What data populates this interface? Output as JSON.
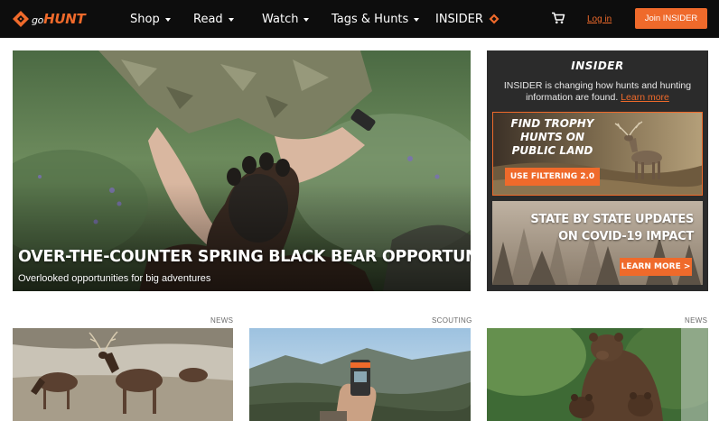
{
  "nav": {
    "logo": {
      "go": "go",
      "hunt": "HUNT"
    },
    "items": [
      {
        "label": "Shop",
        "has_dropdown": true
      },
      {
        "label": "Read",
        "has_dropdown": true
      },
      {
        "label": "Watch",
        "has_dropdown": true
      },
      {
        "label": "Tags & Hunts",
        "has_dropdown": true
      },
      {
        "label": "INSIDER",
        "icon": "insider-logo-icon"
      }
    ],
    "cart_icon": "cart-icon",
    "login_label": "Log in",
    "join_label": "Join INSIDER"
  },
  "hero": {
    "title": "OVER-THE-COUNTER SPRING BLACK BEAR OPPORTUNITIES",
    "subtitle": "Overlooked opportunities for big adventures"
  },
  "insider": {
    "logo": "INSIDER",
    "text": "INSIDER is changing how hunts and hunting information are found.",
    "learn_more": "Learn more",
    "promo1": {
      "headline": "FIND TROPHY HUNTS ON PUBLIC LAND",
      "button": "USE FILTERING 2.0"
    },
    "promo2": {
      "headline": "STATE BY STATE UPDATES ON COVID-19 IMPACT",
      "button": "LEARN MORE >"
    }
  },
  "cards": [
    {
      "tag": "NEWS"
    },
    {
      "tag": "SCOUTING"
    },
    {
      "tag": "NEWS"
    }
  ],
  "colors": {
    "accent": "#ef6a2b",
    "nav_bg": "#0d0d0d",
    "panel_bg": "#2b2b2b"
  }
}
